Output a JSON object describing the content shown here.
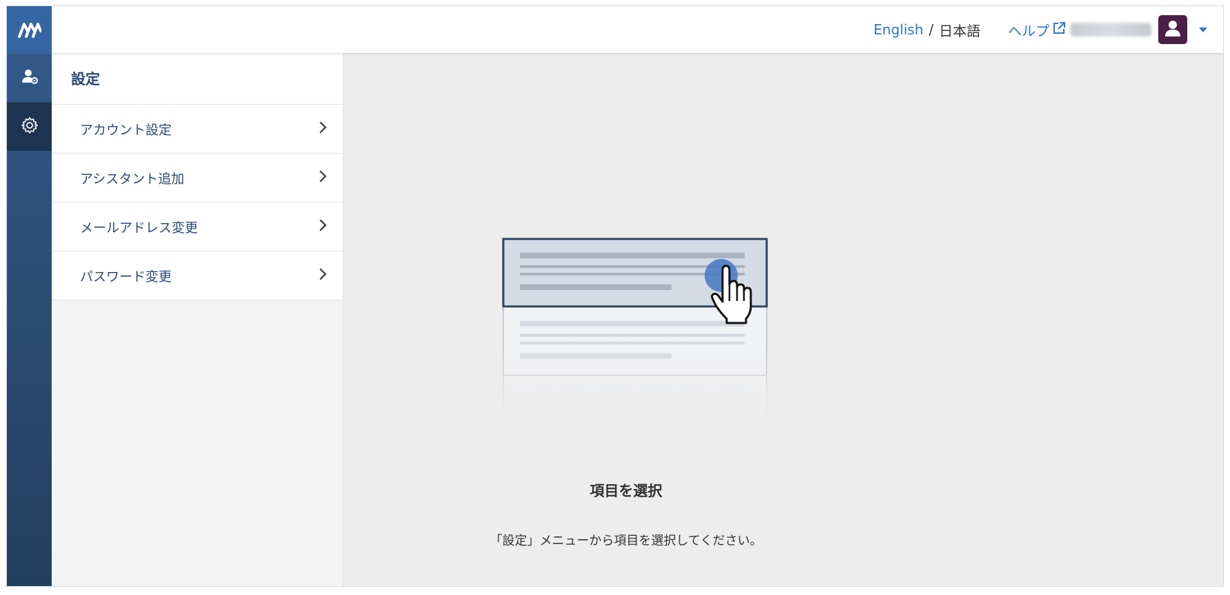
{
  "header": {
    "lang_english": "English",
    "lang_separator": "/",
    "lang_japanese": "日本語",
    "help_label": "ヘルプ"
  },
  "settings_panel": {
    "title": "設定",
    "items": [
      {
        "label": "アカウント設定"
      },
      {
        "label": "アシスタント追加"
      },
      {
        "label": "メールアドレス変更"
      },
      {
        "label": "パスワード変更"
      }
    ]
  },
  "main": {
    "empty_title": "項目を選択",
    "empty_description": "「設定」メニューから項目を選択してください。"
  },
  "icons": {
    "logo": "logo-icon",
    "user_settings": "user-settings-icon",
    "settings": "gear-icon",
    "external_link": "external-link-icon",
    "avatar": "person-icon",
    "dropdown": "caret-down-icon",
    "chevron": "chevron-right-icon"
  },
  "colors": {
    "accent": "#2e76c4",
    "rail_top": "#3565a3",
    "rail_bottom": "#243f5e",
    "menu_text": "#2a4a72",
    "avatar_bg": "#4b1e48"
  }
}
